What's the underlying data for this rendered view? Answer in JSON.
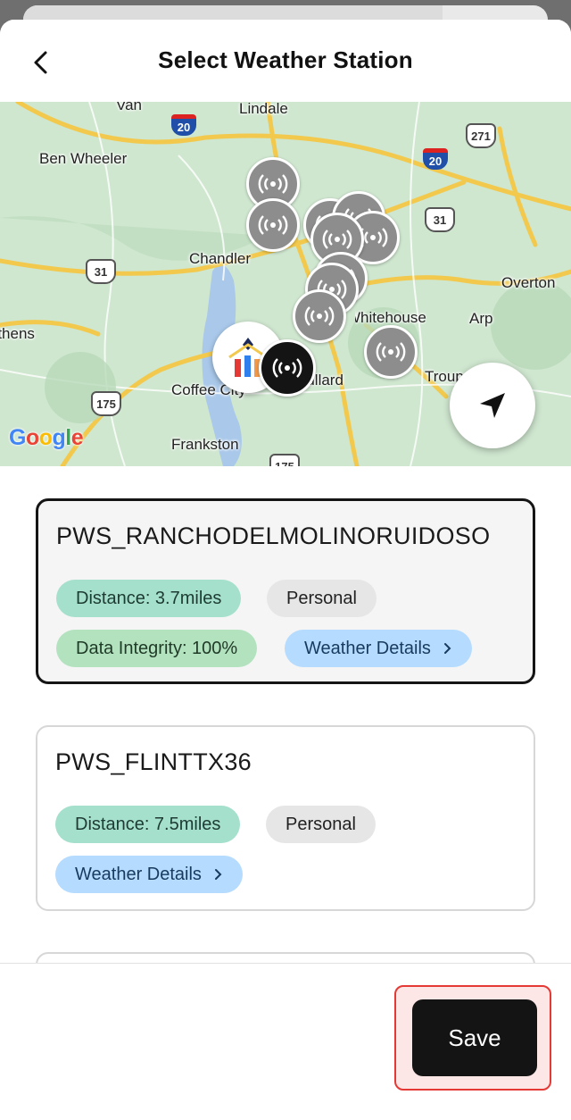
{
  "header": {
    "title": "Select Weather Station",
    "back_icon": "chevron-left-icon"
  },
  "map": {
    "places": [
      "Lindale",
      "Van",
      "Ben Wheeler",
      "Chandler",
      "Overton",
      "Arp",
      "Whitehouse",
      "Coffee City",
      "Bullard",
      "Frankston",
      "Troup",
      "Athens"
    ],
    "highways": [
      "20",
      "20",
      "271",
      "31",
      "31",
      "175",
      "175"
    ],
    "google_label": "Google",
    "colors": {
      "land": "#cfe6cf",
      "road": "#f2c94c",
      "water": "#a9c8ea",
      "station": "#8d8d8d",
      "selected_station": "#141414"
    }
  },
  "stations": [
    {
      "name": "PWS_RANCHODELMOLINORUIDOSO",
      "distance": "Distance: 3.7miles",
      "type": "Personal",
      "integrity": "Data Integrity: 100%",
      "details_label": "Weather Details",
      "selected": true
    },
    {
      "name": "PWS_FLINTTX36",
      "distance": "Distance: 7.5miles",
      "type": "Personal",
      "details_label": "Weather Details",
      "selected": false
    }
  ],
  "footer": {
    "save_label": "Save"
  }
}
